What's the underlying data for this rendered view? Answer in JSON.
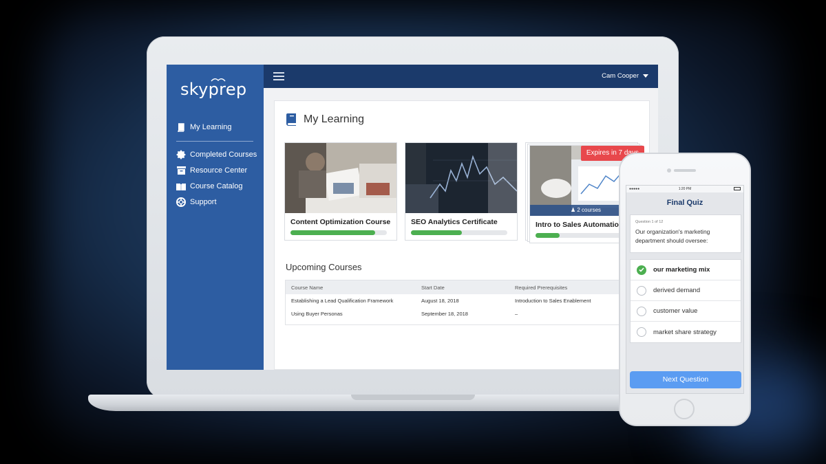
{
  "app": {
    "brand": "skyprep"
  },
  "topbar": {
    "user_name": "Cam Cooper"
  },
  "sidebar": {
    "items": [
      {
        "label": "My Learning",
        "icon": "book-icon"
      },
      {
        "label": "Completed Courses",
        "icon": "badge-icon"
      },
      {
        "label": "Resource Center",
        "icon": "archive-icon"
      },
      {
        "label": "Course Catalog",
        "icon": "catalog-icon"
      },
      {
        "label": "Support",
        "icon": "lifebuoy-icon"
      }
    ]
  },
  "main": {
    "title": "My Learning",
    "cards": [
      {
        "title": "Content Optimization Course",
        "progress": 0.88
      },
      {
        "title": "SEO Analytics Certificate",
        "progress": 0.53
      },
      {
        "title": "Intro to Sales Automation",
        "progress": 0.25,
        "expire_badge": "Expires in 7 days",
        "courses_badge": "2 courses"
      }
    ],
    "upcoming": {
      "title": "Upcoming Courses",
      "columns": [
        "Course Name",
        "Start Date",
        "Required Prerequisites"
      ],
      "rows": [
        [
          "Establishing a Lead Qualification Framework",
          "August 18, 2018",
          "Introduction to Sales Enablement"
        ],
        [
          "Using Buyer Personas",
          "September 18, 2018",
          "–"
        ]
      ]
    }
  },
  "phone": {
    "status_time": "1:20 PM",
    "quiz_title": "Final Quiz",
    "question_num": "Question 1 of 12",
    "question_text": "Our organization's marketing department should oversee:",
    "options": [
      {
        "label": "our marketing mix",
        "selected": true
      },
      {
        "label": "derived demand",
        "selected": false
      },
      {
        "label": "customer value",
        "selected": false
      },
      {
        "label": "market share strategy",
        "selected": false
      }
    ],
    "next_label": "Next Question"
  },
  "colors": {
    "sidebar": "#2d5da2",
    "topbar": "#1b3a6b",
    "progress": "#4caf50",
    "expire": "#e8484c",
    "button": "#5b9cf2"
  }
}
